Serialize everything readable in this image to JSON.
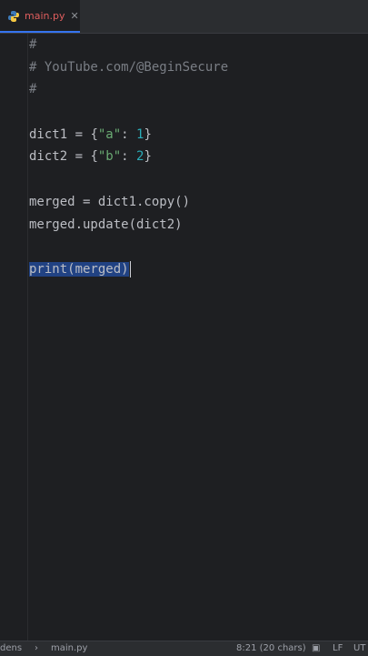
{
  "tab": {
    "filename": "main.py"
  },
  "code": {
    "l1": "#",
    "l2": "# YouTube.com/@BeginSecure",
    "l3": "#",
    "l5_var": "dict1",
    "l5_eq": " = {",
    "l5_key": "\"a\"",
    "l5_colon": ": ",
    "l5_val": "1",
    "l5_end": "}",
    "l6_var": "dict2",
    "l6_eq": " = {",
    "l6_key": "\"b\"",
    "l6_colon": ": ",
    "l6_val": "2",
    "l6_end": "}",
    "l8": "merged = dict1.copy()",
    "l9": "merged.update(dict2)",
    "l11": "print(merged)"
  },
  "statusbar": {
    "left": "dens",
    "sep": "›",
    "file": "main.py",
    "position": "8:21 (20 chars)",
    "line_ending": "LF",
    "encoding": "UT"
  },
  "colors": {
    "comment": "#7a7e85",
    "string": "#6aab73",
    "number": "#2aacb8",
    "selection": "#214283"
  }
}
